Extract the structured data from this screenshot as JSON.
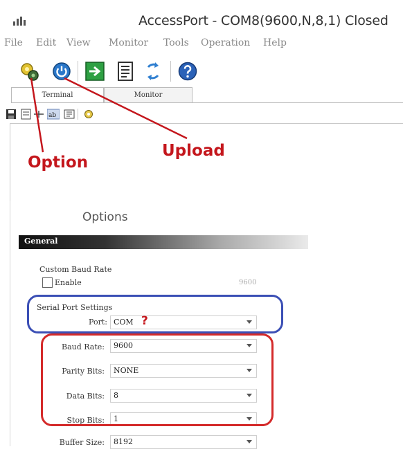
{
  "window": {
    "title": "AccessPort - COM8(9600,N,8,1) Closed"
  },
  "menu": {
    "items": [
      "File",
      "Edit",
      "View",
      "Monitor",
      "Tools",
      "Operation",
      "Help"
    ]
  },
  "toolbar": {
    "icons": [
      "option-icon",
      "upload-icon",
      "connect-icon",
      "document-icon",
      "refresh-icon",
      "help-icon"
    ]
  },
  "tabs": {
    "items": [
      "Terminal",
      "Monitor"
    ]
  },
  "annotations": {
    "option": "Option",
    "upload": "Upload",
    "color": "#c4161c"
  },
  "options": {
    "title": "Options",
    "section": "General",
    "custom_baud_label": "Custom Baud Rate",
    "enable_label": "Enable",
    "custom_baud_value": "9600",
    "serial_group_label": "Serial Port Settings",
    "port_label": "Port:",
    "port_value": "COM",
    "port_question": "?",
    "baud_label": "Baud Rate:",
    "baud_value": "9600",
    "parity_label": "Parity Bits:",
    "parity_value": "NONE",
    "data_label": "Data Bits:",
    "data_value": "8",
    "stop_label": "Stop Bits:",
    "stop_value": "1",
    "buffer_label": "Buffer Size:",
    "buffer_value": "8192"
  },
  "colors": {
    "highlight_blue": "#3b4fb5",
    "highlight_red": "#d42a2a"
  }
}
